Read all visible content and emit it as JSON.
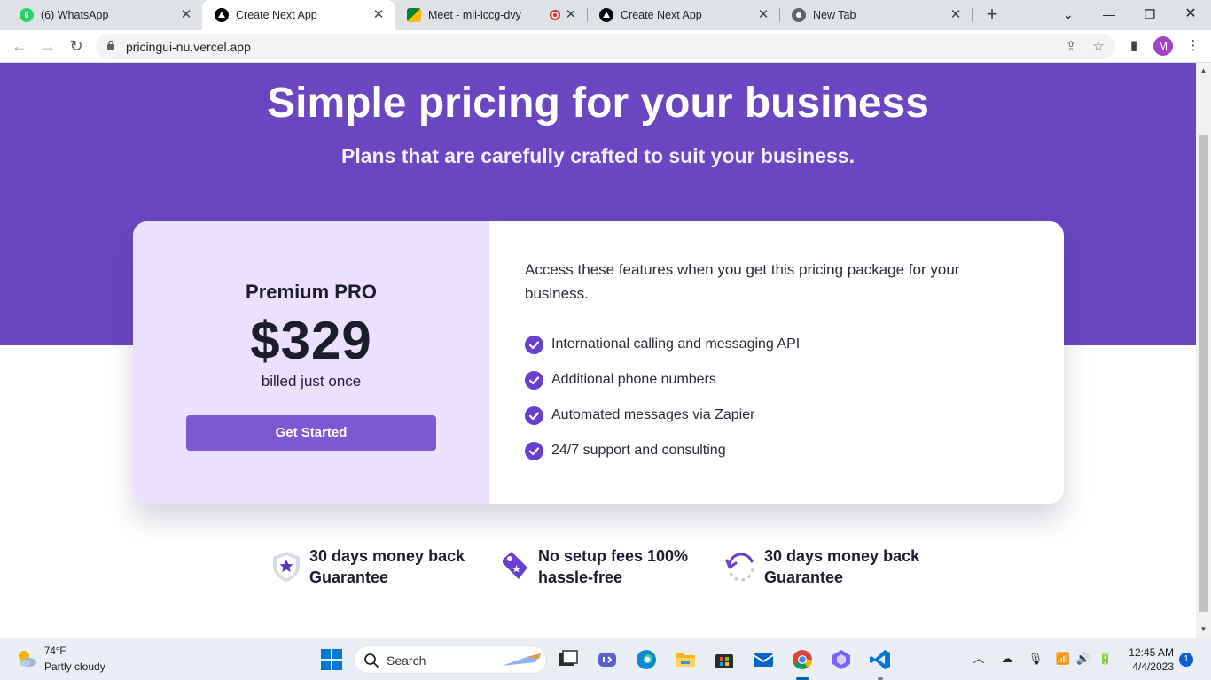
{
  "browser": {
    "tabs": [
      {
        "title": "(6) WhatsApp",
        "icon": "whatsapp-icon",
        "badge": "6"
      },
      {
        "title": "Create Next App",
        "icon": "nextjs-icon"
      },
      {
        "title": "Meet - mii-iccg-dvy",
        "icon": "google-meet-icon"
      },
      {
        "title": "Create Next App",
        "icon": "nextjs-icon"
      },
      {
        "title": "New Tab",
        "icon": "chrome-icon"
      }
    ],
    "active_tab_index": 1,
    "url": "pricingui-nu.vercel.app",
    "profile_initial": "M"
  },
  "page": {
    "hero": {
      "title": "Simple pricing for your business",
      "subtitle": "Plans that are carefully crafted to suit your business."
    },
    "plan": {
      "name": "Premium PRO",
      "price": "$329",
      "billing": "billed just once",
      "cta_label": "Get Started"
    },
    "features": {
      "intro": "Access these features when you get this pricing package for your business.",
      "items": [
        "International calling and messaging API",
        "Additional phone numbers",
        "Automated messages via Zapier",
        "24/7 support and consulting"
      ]
    },
    "guarantees": [
      {
        "text": "30 days money back\nGuarantee",
        "icon": "shield-star-icon"
      },
      {
        "text": "No setup fees 100%\nhassle-free",
        "icon": "price-tag-icon"
      },
      {
        "text": "30 days money back\nGuarantee",
        "icon": "refresh-icon"
      }
    ],
    "colors": {
      "brand_purple": "#6a47c1",
      "button_purple": "#7e57d2",
      "card_left_bg": "#ebe0ff"
    }
  },
  "taskbar": {
    "weather": {
      "temp": "74°F",
      "desc": "Partly cloudy"
    },
    "search_label": "Search",
    "time": "12:45 AM",
    "date": "4/4/2023",
    "notifications": "1"
  }
}
